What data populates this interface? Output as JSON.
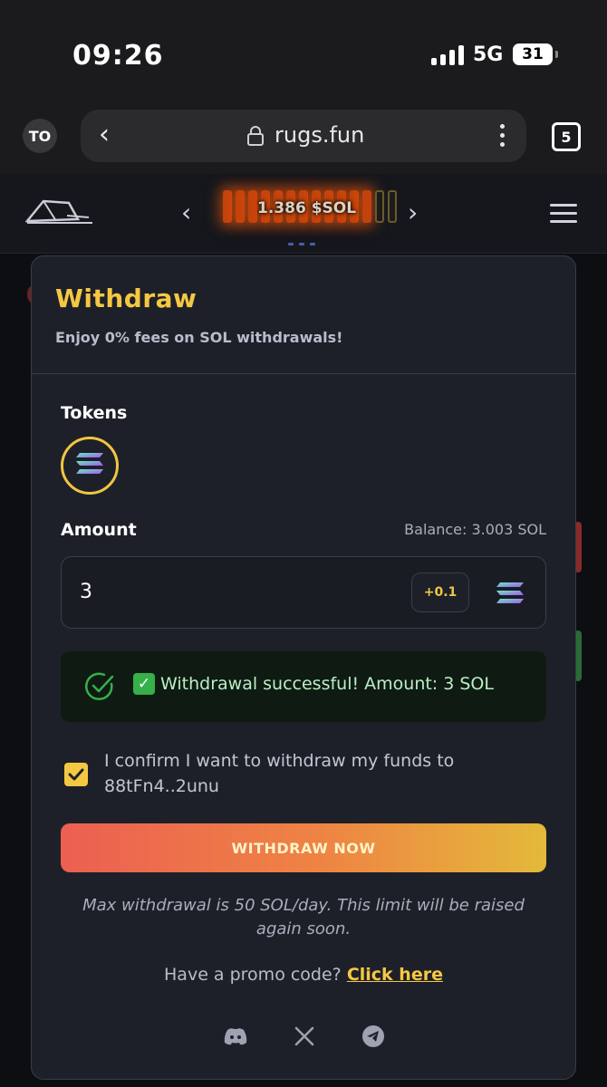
{
  "status_bar": {
    "time": "09:26",
    "network": "5G",
    "battery": "31"
  },
  "browser": {
    "tab_avatar": "TO",
    "url": "rugs.fun",
    "tab_count": "5"
  },
  "header": {
    "price": "1.386 $SOL"
  },
  "modal": {
    "title": "Withdraw",
    "subtitle": "Enjoy 0% fees on SOL withdrawals!",
    "tokens_label": "Tokens",
    "amount_label": "Amount",
    "balance": "Balance: 3.003 SOL",
    "amount_value": "3",
    "increment_label": "+0.1",
    "success_message": "Withdrawal successful! Amount: 3 SOL",
    "confirm_text": "I confirm I want to withdraw my funds to 88tFn4..2unu",
    "confirm_checked": true,
    "withdraw_button": "WITHDRAW NOW",
    "limit_note": "Max withdrawal is 50 SOL/day. This limit will be raised again soon.",
    "promo_prefix": "Have a promo code?",
    "promo_link": "Click here",
    "socials": [
      "discord-icon",
      "x-icon",
      "telegram-icon"
    ]
  },
  "colors": {
    "accent_yellow": "#f5c842",
    "success_green": "#35b04a",
    "button_gradient_start": "#ec5f52",
    "button_gradient_end": "#e4b93a",
    "modal_bg": "#1e2029"
  }
}
